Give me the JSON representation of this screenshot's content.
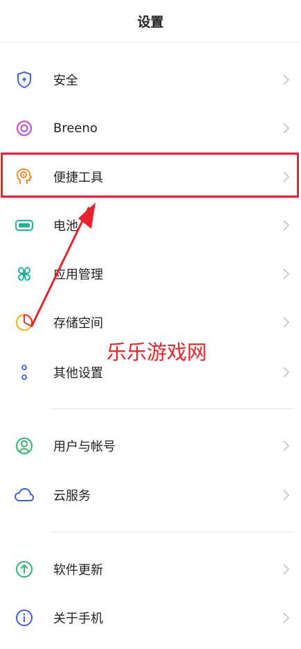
{
  "header": {
    "title": "设置"
  },
  "groups": {
    "main": [
      {
        "label": "安全",
        "icon": "shield-icon"
      },
      {
        "label": "Breeno",
        "icon": "breeno-icon"
      },
      {
        "label": "便捷工具",
        "icon": "convenience-tools-icon"
      },
      {
        "label": "电池",
        "icon": "battery-icon"
      },
      {
        "label": "应用管理",
        "icon": "app-management-icon"
      },
      {
        "label": "存储空间",
        "icon": "storage-icon"
      },
      {
        "label": "其他设置",
        "icon": "more-settings-icon"
      }
    ],
    "account": [
      {
        "label": "用户与帐号",
        "icon": "user-account-icon"
      },
      {
        "label": "云服务",
        "icon": "cloud-icon"
      }
    ],
    "system": [
      {
        "label": "软件更新",
        "icon": "software-update-icon"
      },
      {
        "label": "关于手机",
        "icon": "about-phone-icon"
      }
    ]
  },
  "annotation": {
    "watermark": "乐乐游戏网",
    "color": "#e8232b"
  }
}
